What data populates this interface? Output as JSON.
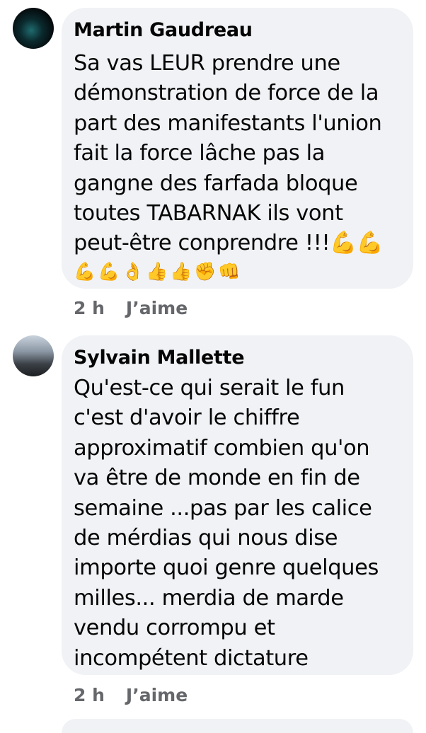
{
  "comments": [
    {
      "author": "Martin Gaudreau",
      "text": "Sa vas LEUR prendre une\ndémonstration de force de la\npart des manifestants l'union\nfait la force lâche pas la\ngangne des farfada bloque\ntoutes TABARNAK ils vont\npeut-être conprendre !!!💪💪",
      "emojis": [
        "💪",
        "💪",
        "👌",
        "👍",
        "👍",
        "✊",
        "👊"
      ],
      "time": "2 h",
      "like_label": "J’aime"
    },
    {
      "author": "Sylvain Mallette",
      "text": "Qu'est-ce qui serait le fun\nc'est d'avoir le chiffre\napproximatif combien qu'on\nva être  de monde en fin de\nsemaine ...pas par les calice\nde  mérdias qui nous dise\nimporte quoi genre quelques\nmilles... merdia de marde\nvendu corrompu et\nincompétent dictature",
      "time": "2 h",
      "like_label": "J’aime"
    }
  ]
}
